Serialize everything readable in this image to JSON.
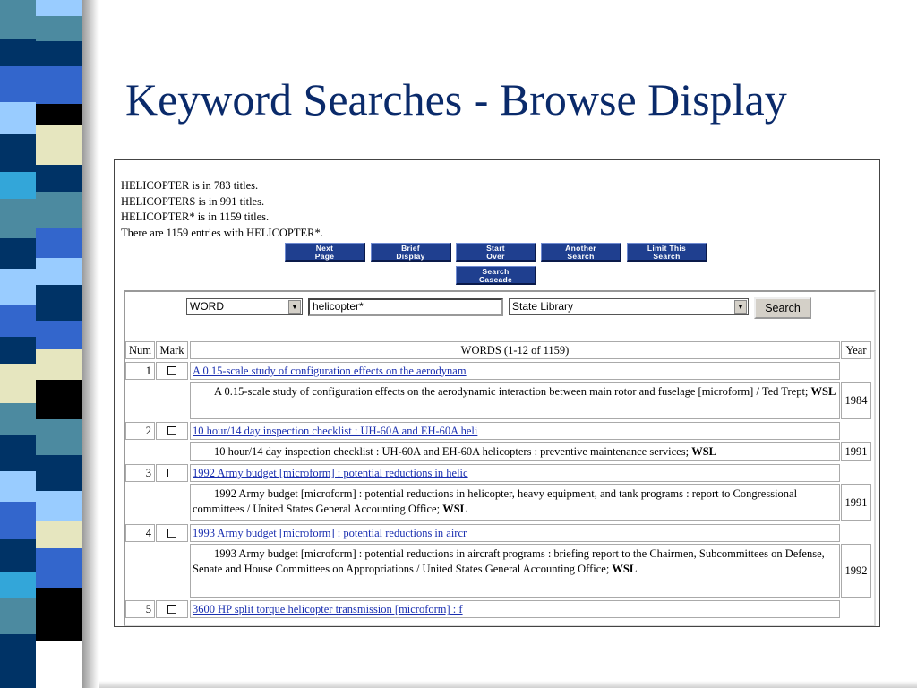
{
  "slide": {
    "title": "Keyword Searches - Browse Display"
  },
  "strip_colors": {
    "dark": "#003366",
    "mid": "#3366cc",
    "teal": "#4c8aa0",
    "light": "#99ccff",
    "cream": "#e6e6bf",
    "black": "#000000",
    "sky": "#33a6d9"
  },
  "info_lines": [
    "HELICOPTER is in 783 titles.",
    "HELICOPTERS is in 991 titles.",
    "HELICOPTER* is in 1159 titles.",
    "There are 1159 entries with HELICOPTER*."
  ],
  "buttons": {
    "next_page": {
      "line1": "Next",
      "line2": "Page"
    },
    "brief_display": {
      "line1": "Brief",
      "line2": "Display"
    },
    "start_over": {
      "line1": "Start",
      "line2": "Over"
    },
    "another_search": {
      "line1": "Another",
      "line2": "Search"
    },
    "limit_search": {
      "line1": "Limit This",
      "line2": "Search"
    },
    "search_cascade": {
      "line1": "Search",
      "line2": "Cascade"
    }
  },
  "search": {
    "field_type": "WORD",
    "query": "helicopter*",
    "scope": "State Library",
    "button": "Search"
  },
  "table": {
    "headers": {
      "num": "Num",
      "mark": "Mark",
      "words": "WORDS (1-12 of 1159)",
      "year": "Year"
    },
    "rows": [
      {
        "num": "1",
        "title": "A 0.15-scale study of configuration effects on the aerodynam",
        "desc": "A 0.15-scale study of configuration effects on the aerodynamic interaction between main rotor and fuselage [microform] / Ted Trept;",
        "loc": "WSL",
        "year": "1984"
      },
      {
        "num": "2",
        "title": "10 hour/14 day inspection checklist : UH-60A and EH-60A heli",
        "desc": "10 hour/14 day inspection checklist : UH-60A and EH-60A helicopters : preventive maintenance services;",
        "loc": "WSL",
        "year": "1991"
      },
      {
        "num": "3",
        "title": "1992 Army budget [microform] : potential reductions in helic",
        "desc": "1992 Army budget [microform] : potential reductions in helicopter, heavy equipment, and tank programs : report to Congressional committees / United States General Accounting Office;",
        "loc": "WSL",
        "year": "1991"
      },
      {
        "num": "4",
        "title": "1993 Army budget [microform] : potential reductions in aircr",
        "desc": "1993 Army budget [microform] : potential reductions in aircraft programs : briefing report to the Chairmen, Subcommittees on Defense, Senate and House Committees on Appropriations / United States General Accounting Office;",
        "loc": "WSL",
        "year": "1992"
      },
      {
        "num": "5",
        "title": "3600 HP split torque helicopter transmission [microform] : f"
      }
    ]
  }
}
